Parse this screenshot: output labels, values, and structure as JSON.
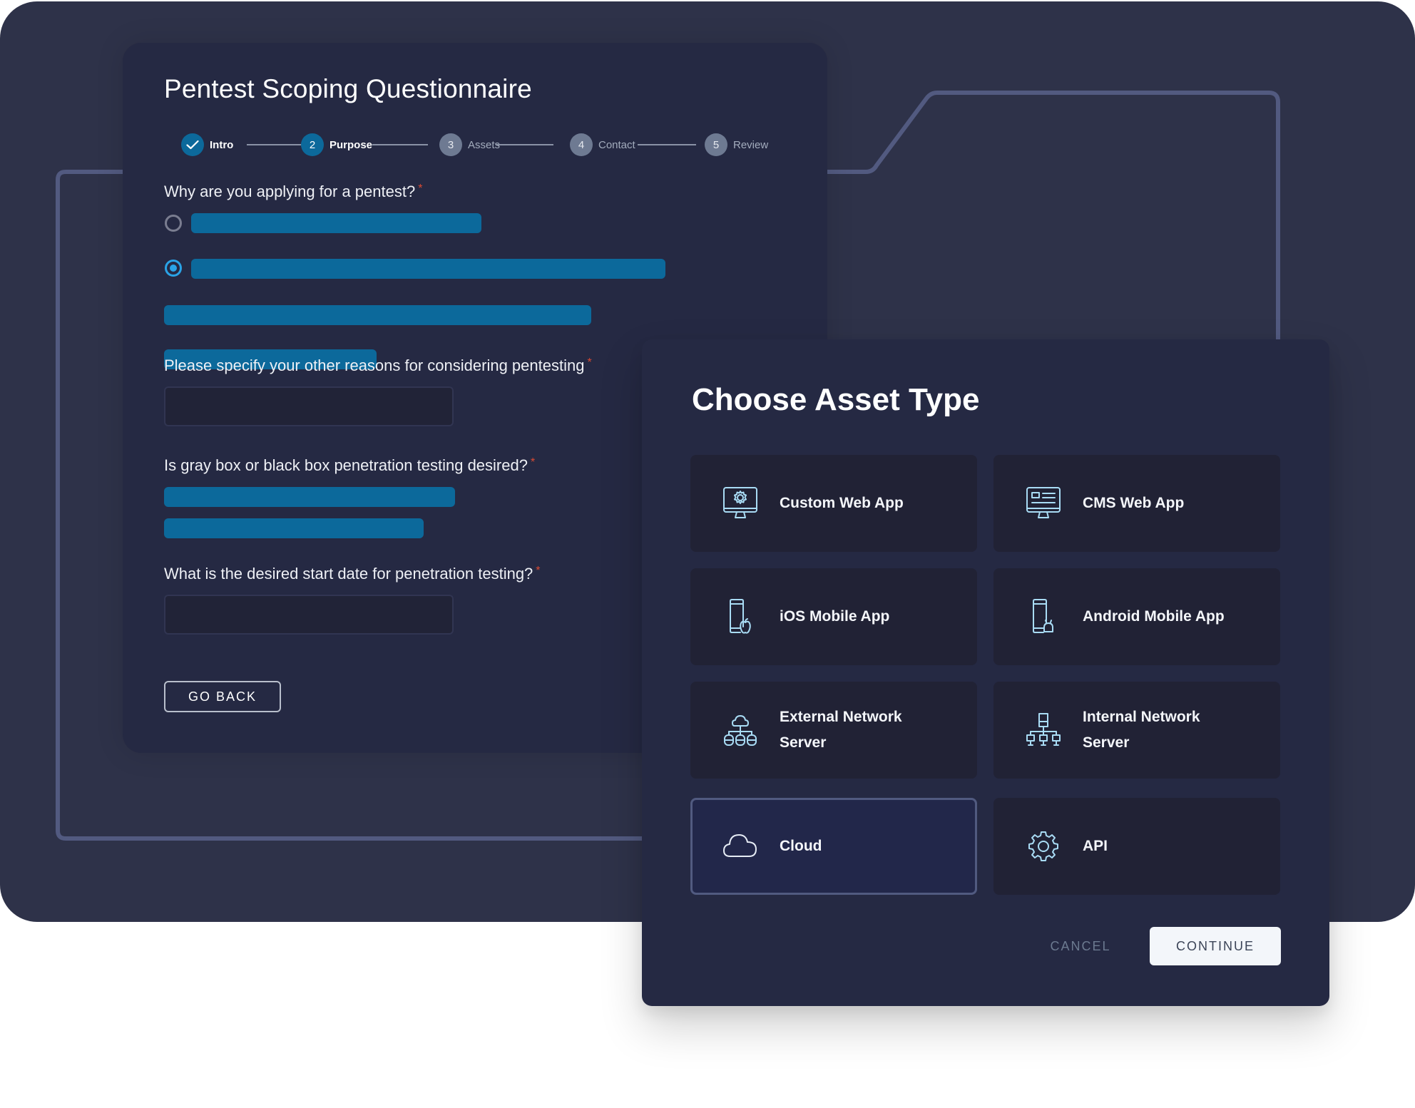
{
  "questionnaire": {
    "title": "Pentest Scoping Questionnaire",
    "steps": [
      {
        "number": "",
        "label": "Intro",
        "state": "completed",
        "icon": "check-icon"
      },
      {
        "number": "2",
        "label": "Purpose",
        "state": "active"
      },
      {
        "number": "3",
        "label": "Assets",
        "state": "pending"
      },
      {
        "number": "4",
        "label": "Contact",
        "state": "pending"
      },
      {
        "number": "5",
        "label": "Review",
        "state": "pending"
      }
    ],
    "questions": [
      {
        "text": "Why are you applying for a pentest?",
        "required_mark": "*",
        "type": "radio",
        "selected_option": 2
      },
      {
        "text": "Please specify your other reasons for considering pentesting",
        "required_mark": "*",
        "type": "text",
        "value": "",
        "placeholder": ""
      },
      {
        "text": "Is gray box or black box penetration testing desired?",
        "required_mark": "*",
        "type": "options"
      },
      {
        "text": "What is the desired start date for penetration testing?",
        "required_mark": "*",
        "type": "text",
        "value": "",
        "placeholder": ""
      }
    ],
    "go_back_label": "GO BACK"
  },
  "modal": {
    "title": "Choose Asset Type",
    "asset_types": [
      {
        "label": "Custom Web App",
        "icon": "monitor-gear-icon",
        "selected": false
      },
      {
        "label": "CMS Web App",
        "icon": "monitor-layout-icon",
        "selected": false
      },
      {
        "label": "iOS Mobile App",
        "icon": "phone-apple-icon",
        "selected": false
      },
      {
        "label": "Android Mobile App",
        "icon": "phone-android-icon",
        "selected": false
      },
      {
        "label": "External Network Server",
        "icon": "cloud-network-icon",
        "selected": false
      },
      {
        "label": "Internal Network Server",
        "icon": "server-network-icon",
        "selected": false
      },
      {
        "label": "Cloud",
        "icon": "cloud-icon",
        "selected": true
      },
      {
        "label": "API",
        "icon": "gear-icon",
        "selected": false
      }
    ],
    "cancel_label": "CANCEL",
    "continue_label": "CONTINUE"
  },
  "colors": {
    "background": "#2e3249",
    "panel": "#252943",
    "card": "#212235",
    "accent_blue": "#0c699b",
    "radio_selected": "#2aa3e6",
    "required": "#d94a33",
    "icon": "#a9dcf5",
    "decor_line": "#525a80"
  }
}
